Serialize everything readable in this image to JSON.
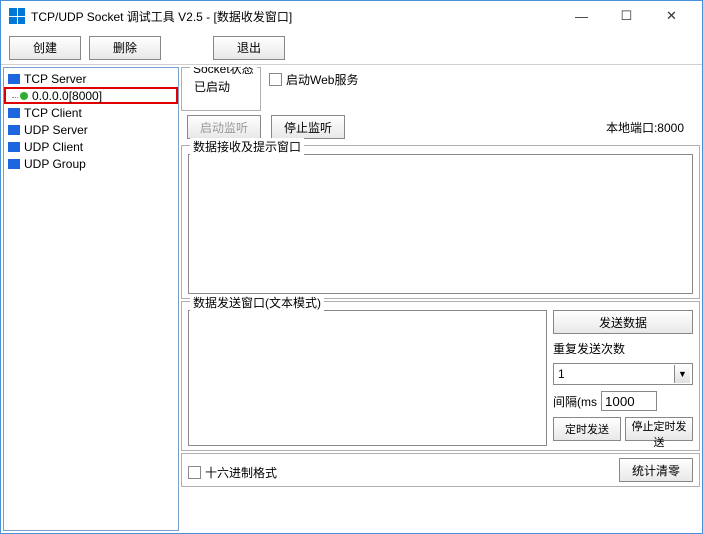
{
  "window": {
    "title": "TCP/UDP Socket 调试工具 V2.5 - [数据收发窗口]"
  },
  "toolbar": {
    "create": "创建",
    "delete": "删除",
    "exit": "退出"
  },
  "tree": {
    "tcp_server": "TCP Server",
    "listener": "0.0.0.0[8000]",
    "tcp_client": "TCP Client",
    "udp_server": "UDP Server",
    "udp_client": "UDP Client",
    "udp_group": "UDP Group"
  },
  "socket": {
    "legend": "Socket状态",
    "status": "已启动"
  },
  "webservice": {
    "label": "启动Web服务"
  },
  "listen": {
    "start": "启动监听",
    "stop": "停止监听",
    "port_label": "本地端口:8000"
  },
  "recv": {
    "legend": "数据接收及提示窗口"
  },
  "send": {
    "legend": "数据发送窗口(文本模式)",
    "send_btn": "发送数据",
    "repeat_label": "重复发送次数",
    "repeat_value": "1",
    "interval_label": "间隔(ms",
    "interval_value": "1000",
    "timer_start": "定时发送",
    "timer_stop": "停止定时发送"
  },
  "bottom": {
    "hex_label": "十六进制格式",
    "stats_btn": "统计清零"
  }
}
